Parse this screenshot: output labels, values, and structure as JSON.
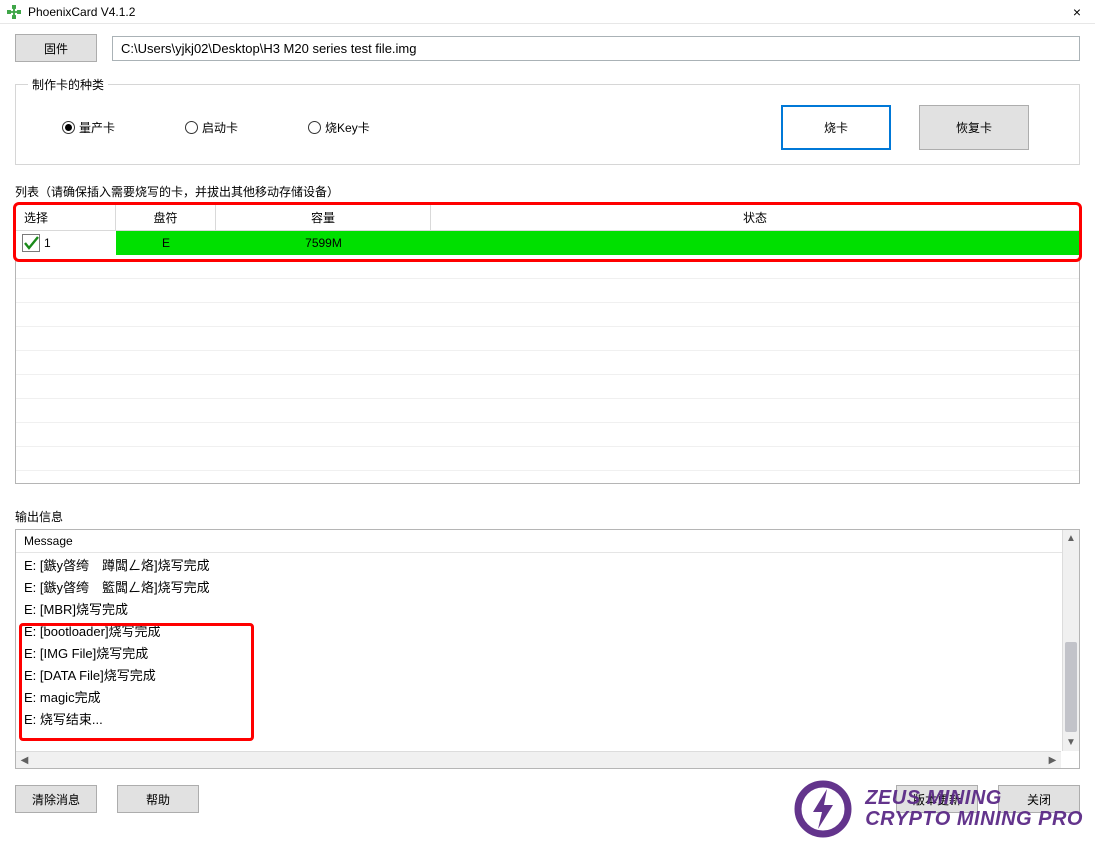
{
  "window": {
    "title": "PhoenixCard V4.1.2",
    "close_symbol": "×"
  },
  "firmware": {
    "button_label": "固件",
    "path": "C:\\Users\\yjkj02\\Desktop\\H3 M20 series test file.img"
  },
  "card_type": {
    "legend": "制作卡的种类",
    "options": {
      "mass": "量产卡",
      "boot": "启动卡",
      "key": "烧Key卡"
    }
  },
  "actions": {
    "burn": "烧卡",
    "restore": "恢复卡"
  },
  "list": {
    "label": "列表（请确保插入需要烧写的卡，并拔出其他移动存储设备）",
    "headers": {
      "select": "选择",
      "drive": "盘符",
      "capacity": "容量",
      "status": "状态"
    },
    "rows": [
      {
        "index": "1",
        "drive": "E",
        "capacity": "7599M",
        "status": ""
      }
    ]
  },
  "output": {
    "label": "输出信息",
    "header": "Message",
    "lines": [
      "E: [鏃у晵绔　蹲闆ㄥ烙]烧写完成",
      "E: [鏃у晵绔　籃闆ㄥ烙]烧写完成",
      "E: [MBR]烧写完成",
      "E: [bootloader]烧写完成",
      "E: [IMG File]烧写完成",
      "E: [DATA File]烧写完成",
      "E: magic完成",
      "E: 烧写结束..."
    ]
  },
  "bottom": {
    "clear": "清除消息",
    "help": "帮助",
    "update": "版本更新",
    "close": "关闭"
  },
  "watermark": {
    "line1": "ZEUS MINING",
    "line2": "CRYPTO MINING PRO"
  }
}
